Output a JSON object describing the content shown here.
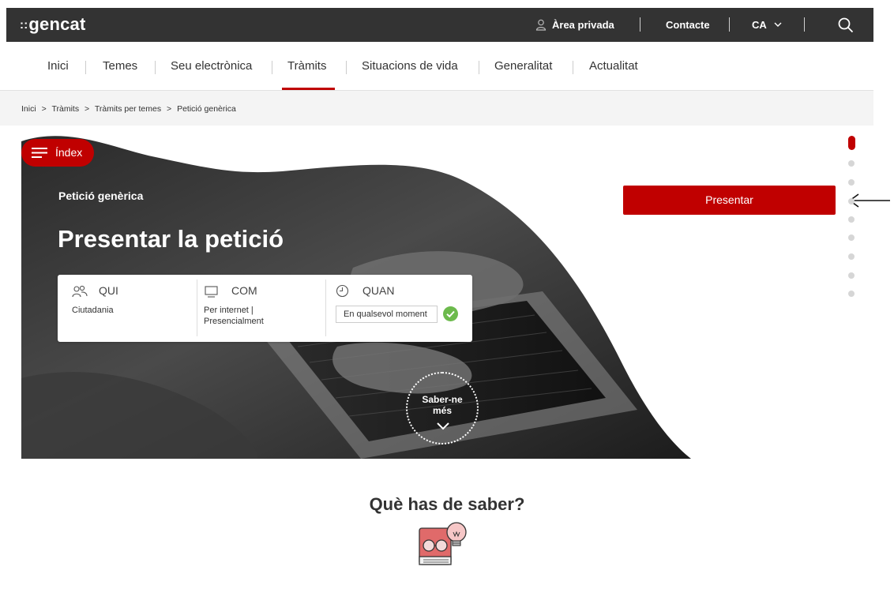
{
  "header": {
    "logo_mark": "::",
    "logo_text": "gencat",
    "private_area": "Àrea privada",
    "contact": "Contacte",
    "language": "CA"
  },
  "nav": {
    "items": [
      "Inici",
      "Temes",
      "Seu electrònica",
      "Tràmits",
      "Situacions de vida",
      "Generalitat",
      "Actualitat"
    ],
    "active": "Tràmits"
  },
  "breadcrumb": [
    "Inici",
    ">",
    "Tràmits",
    ">",
    "Tràmits per temes",
    ">",
    "Petició genèrica"
  ],
  "hero": {
    "index_label": "Índex",
    "subtitle": "Petició genèrica",
    "title": "Presentar la petició",
    "qui_label": "QUI",
    "qui_value": "Ciutadania",
    "com_label": "COM",
    "com_value_1": "Per internet |",
    "com_value_2": "Presencialment",
    "quan_label": "QUAN",
    "quan_value": "En qualsevol moment",
    "more_1": "Saber-ne",
    "more_2": "més"
  },
  "actions": {
    "present_label": "Presentar"
  },
  "section": {
    "title": "Què has de saber?"
  },
  "colors": {
    "accent": "#c00000",
    "topbar": "#333333",
    "check": "#6cba4c"
  },
  "icons": [
    "user-icon",
    "chevron-down-icon",
    "search-icon",
    "menu-icon",
    "people-icon",
    "monitor-icon",
    "clock-icon",
    "check-icon",
    "arrow-left-icon",
    "book-lightbulb-icon"
  ]
}
